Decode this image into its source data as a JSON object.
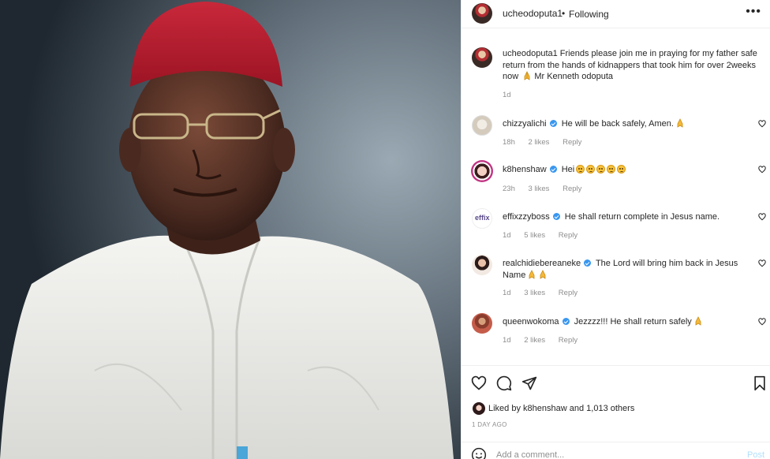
{
  "post": {
    "header": {
      "username": "ucheodoputa1",
      "separator": "•",
      "follow_status": "Following",
      "more_label": "•••"
    },
    "caption": {
      "username": "ucheodoputa1",
      "text": "Friends please join me in praying for my father safe return from the hands of kidnappers that took him for over 2weeks now",
      "text_suffix": "Mr Kenneth odoputa",
      "time": "1d"
    },
    "comments": [
      {
        "username": "chizzyalichi",
        "verified": true,
        "text": "He will be back safely, Amen.",
        "emoji": "pray",
        "time": "18h",
        "likes": "2 likes",
        "reply": "Reply"
      },
      {
        "username": "k8henshaw",
        "verified": true,
        "text": "Hei",
        "emoji": "sad x5",
        "time": "23h",
        "likes": "3 likes",
        "reply": "Reply"
      },
      {
        "username": "effixzzyboss",
        "verified": true,
        "text": "He shall return complete in Jesus name.",
        "time": "1d",
        "likes": "5 likes",
        "reply": "Reply"
      },
      {
        "username": "realchidiebereaneke",
        "verified": true,
        "text": "The Lord will bring him back in Jesus Name",
        "emoji": "pray x2",
        "time": "1d",
        "likes": "3 likes",
        "reply": "Reply"
      },
      {
        "username": "queenwokoma",
        "verified": true,
        "text": "Jezzzz!!! He shall return safely",
        "emoji": "pray",
        "time": "1d",
        "likes": "2 likes",
        "reply": "Reply"
      }
    ],
    "effix_avatar_text": "effix",
    "likes": {
      "prefix": "Liked by",
      "user": "k8henshaw",
      "suffix": "and 1,013 others"
    },
    "posted_ago": "1 DAY AGO",
    "add_comment": {
      "placeholder": "Add a comment...",
      "post_label": "Post"
    },
    "icons": [
      "heart-icon",
      "comment-icon",
      "share-icon",
      "bookmark-icon",
      "smile-icon",
      "more-icon",
      "verified-icon"
    ],
    "colors": {
      "verified": "#3897f0",
      "muted": "#8e8e8e",
      "post_button": "#b2dffc",
      "text": "#262626"
    }
  }
}
